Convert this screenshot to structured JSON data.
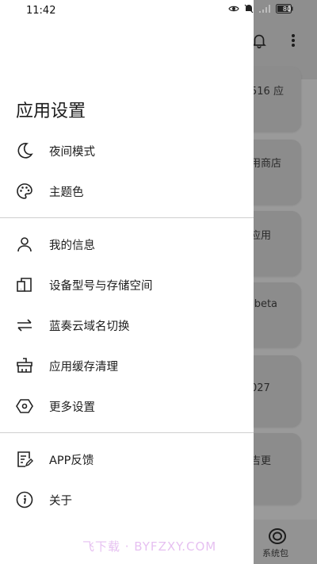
{
  "status_bar": {
    "time": "11:42",
    "battery": "80"
  },
  "drawer": {
    "title": "应用设置",
    "section1": [
      {
        "label": "夜间模式",
        "icon": "moon-icon"
      },
      {
        "label": "主题色",
        "icon": "palette-icon"
      }
    ],
    "section2": [
      {
        "label": "我的信息",
        "icon": "person-icon"
      },
      {
        "label": "设备型号与存储空间",
        "icon": "device-storage-icon"
      },
      {
        "label": "蓝奏云域名切换",
        "icon": "swap-arrows-icon"
      },
      {
        "label": "应用缓存清理",
        "icon": "broom-icon"
      },
      {
        "label": "更多设置",
        "icon": "hexagon-settings-icon"
      }
    ],
    "section3": [
      {
        "label": "APP反馈",
        "icon": "feedback-edit-icon"
      },
      {
        "label": "关于",
        "icon": "info-icon"
      }
    ]
  },
  "background": {
    "cards": [
      "516 应",
      "用商店",
      "应用",
      "-beta",
      "027",
      "吉更"
    ],
    "bottom_nav_label": "系统包"
  },
  "watermark": "飞下载 · BYFZXY.COM"
}
